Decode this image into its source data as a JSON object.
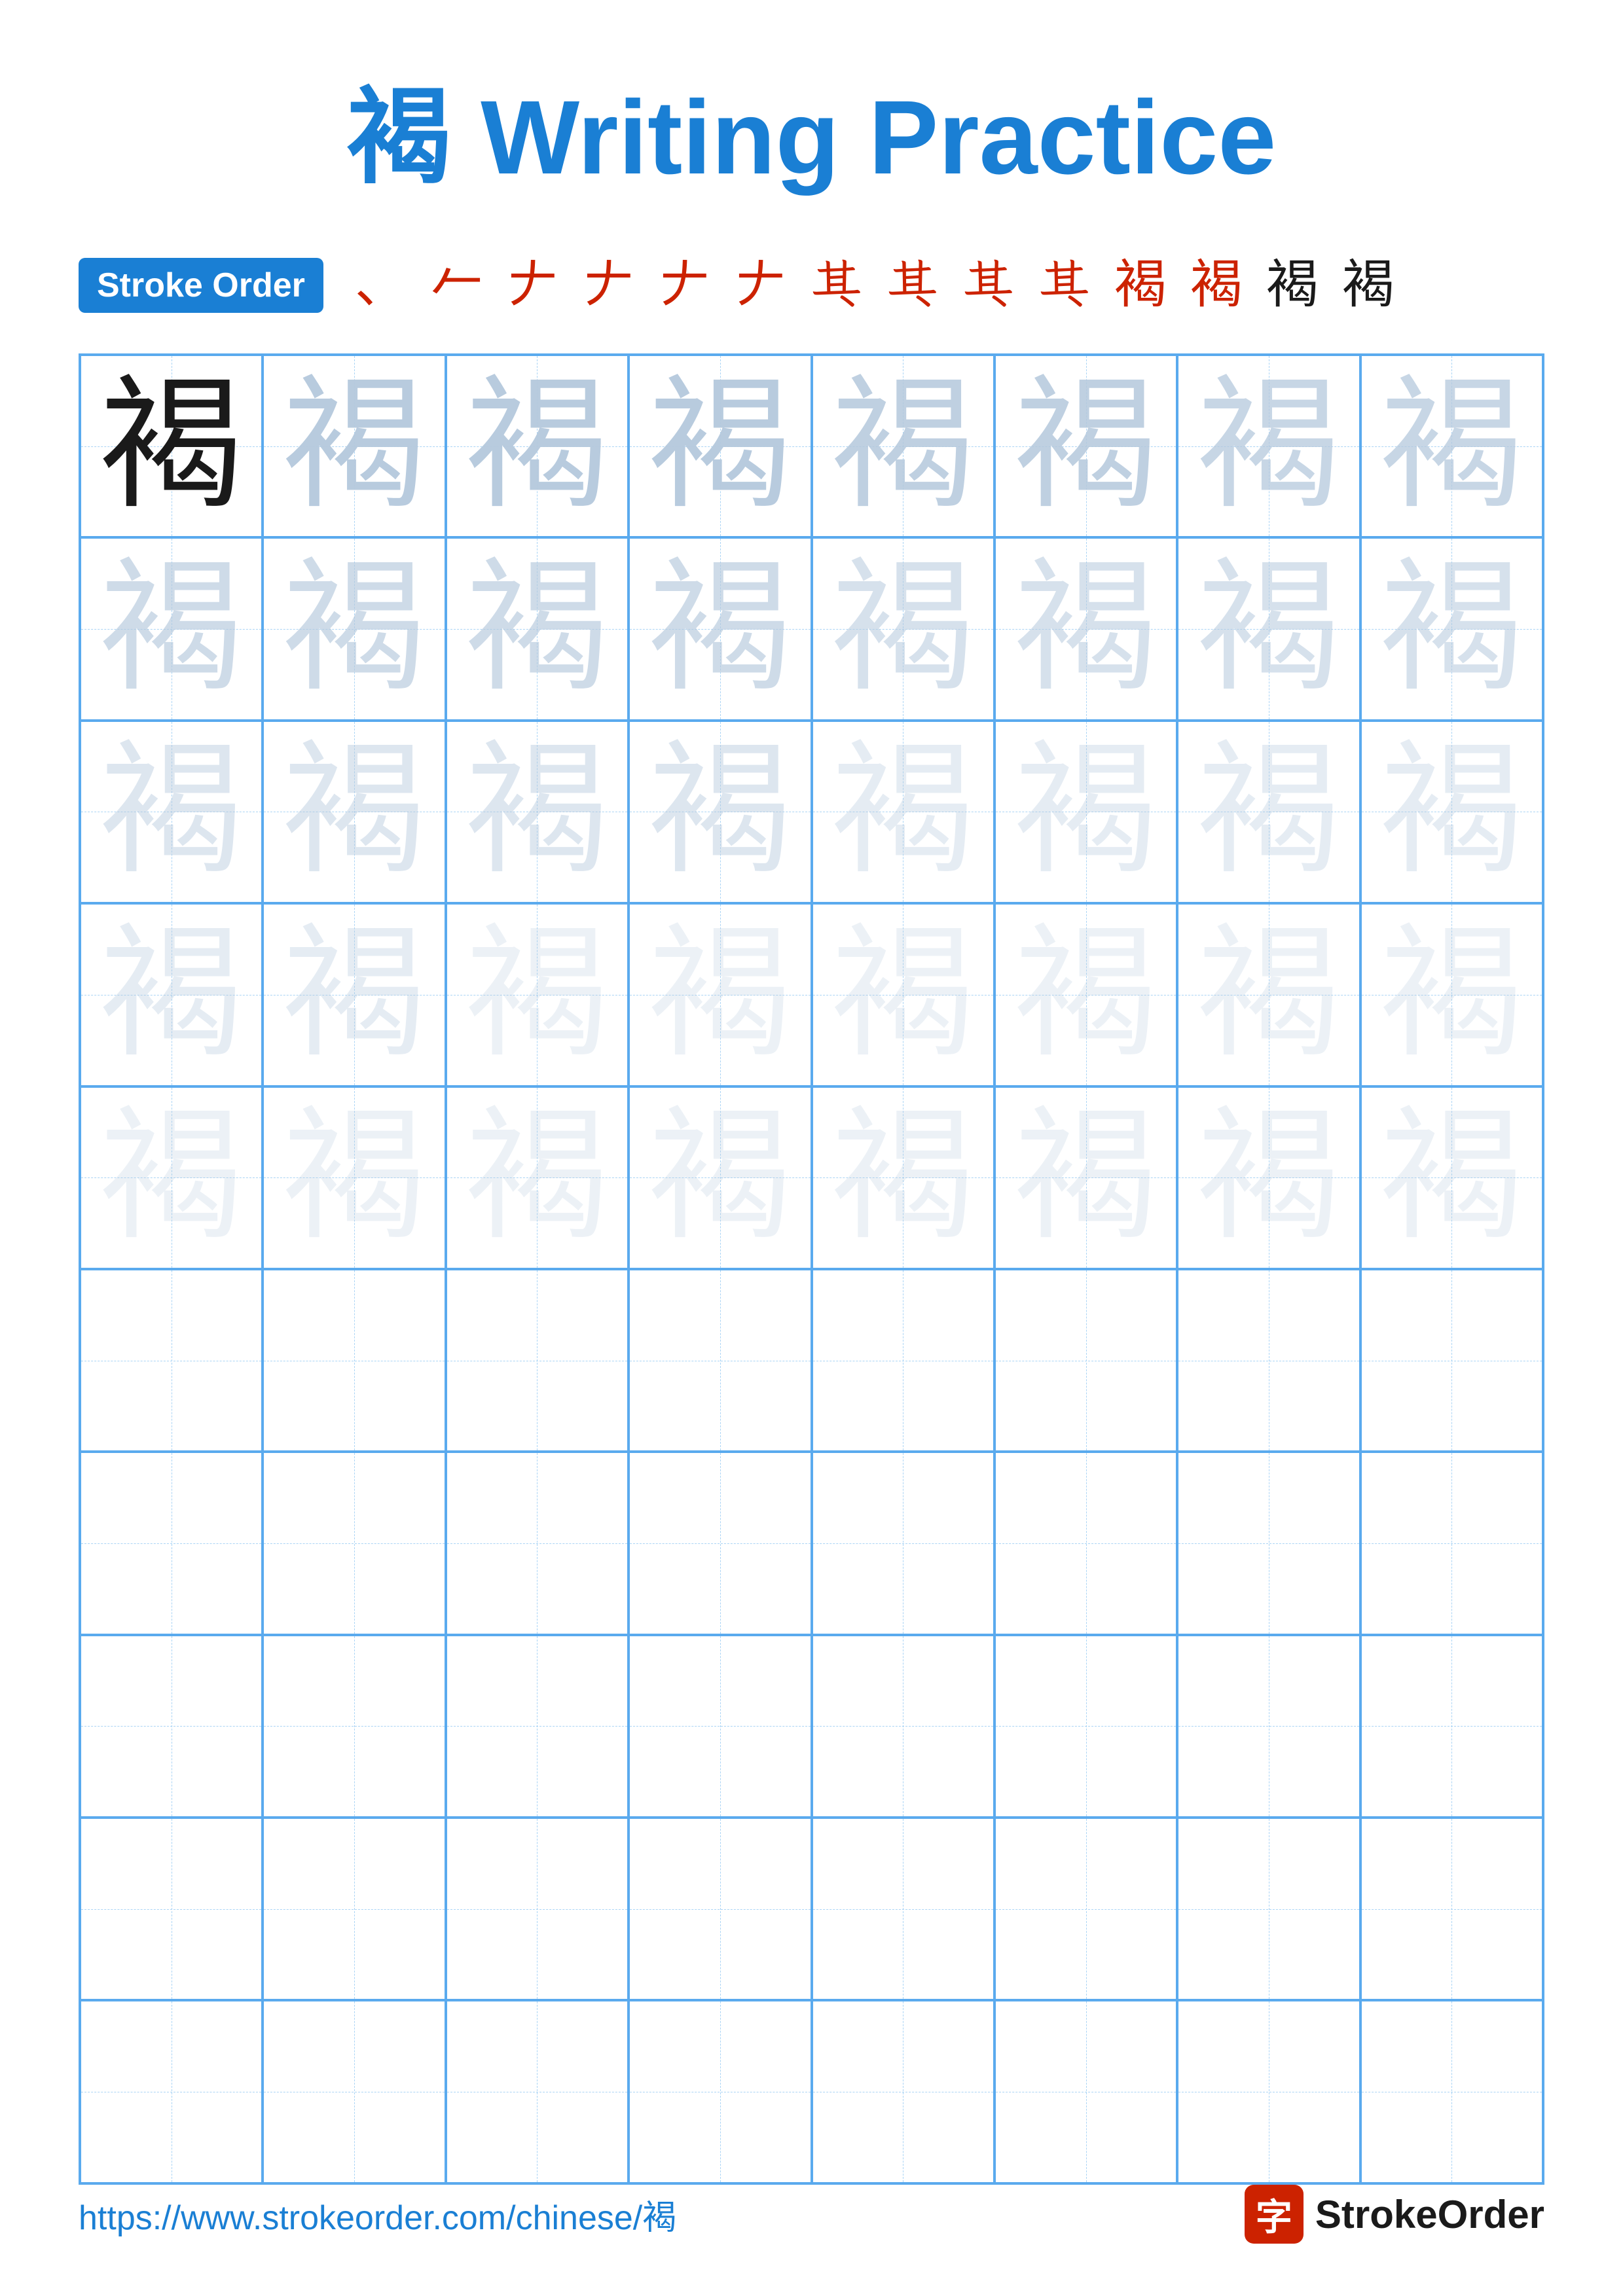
{
  "title": "褐 Writing Practice",
  "stroke_order_label": "Stroke Order",
  "stroke_chars": [
    "、",
    "𠂉",
    "𠂉",
    "𠂉",
    "𠂉",
    "𠂉",
    "𠀱",
    "𠀱",
    "𠀱",
    "𠀱",
    "褐",
    "褐",
    "褐",
    "褐"
  ],
  "character": "褐",
  "footer_url": "https://www.strokeorder.com/chinese/褐",
  "footer_logo_char": "字",
  "footer_brand": "StrokeOrder",
  "rows": [
    {
      "type": "practice",
      "opacities": [
        "solid",
        "op-1",
        "op-1",
        "op-1",
        "op-2",
        "op-2",
        "op-3",
        "op-3"
      ]
    },
    {
      "type": "practice",
      "opacities": [
        "op-4",
        "op-4",
        "op-4",
        "op-5",
        "op-5",
        "op-5",
        "op-6",
        "op-6"
      ]
    },
    {
      "type": "practice",
      "opacities": [
        "op-6",
        "op-6",
        "op-7",
        "op-7",
        "op-7",
        "op-7",
        "op-7",
        "op-7"
      ]
    },
    {
      "type": "practice",
      "opacities": [
        "op-7",
        "op-7",
        "op-8",
        "op-8",
        "op-8",
        "op-8",
        "op-8",
        "op-8"
      ]
    },
    {
      "type": "practice",
      "opacities": [
        "op-8",
        "op-8",
        "op-8",
        "op-8",
        "op-8",
        "op-8",
        "op-8",
        "op-8"
      ]
    },
    {
      "type": "empty"
    },
    {
      "type": "empty"
    },
    {
      "type": "empty"
    },
    {
      "type": "empty"
    },
    {
      "type": "empty"
    }
  ]
}
